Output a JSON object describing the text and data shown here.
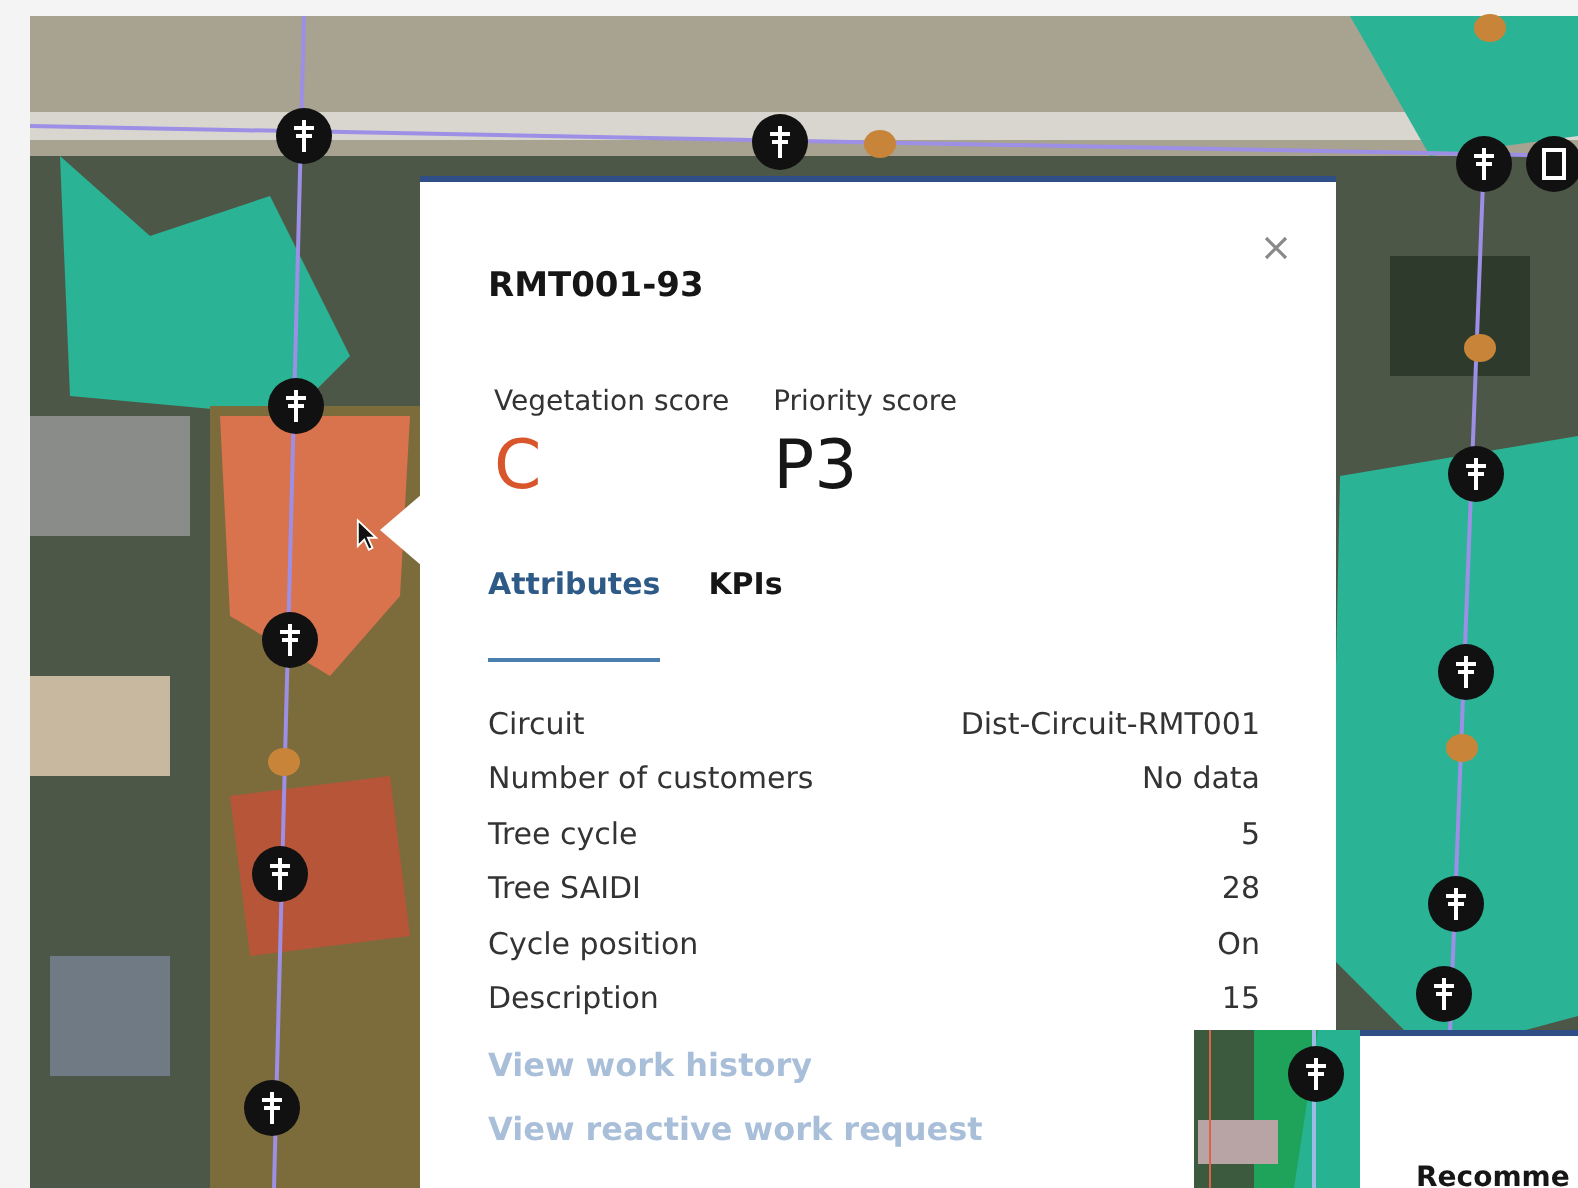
{
  "popup": {
    "title": "RMT001-93",
    "scores": [
      {
        "label": "Vegetation score",
        "value": "C",
        "color": "#d9552b"
      },
      {
        "label": "Priority score",
        "value": "P3",
        "color": "#161616"
      }
    ],
    "tabs": [
      {
        "label": "Attributes",
        "selected": true
      },
      {
        "label": "KPIs",
        "selected": false
      }
    ],
    "attributes": [
      {
        "label": "Circuit",
        "value": "Dist-Circuit-RMT001"
      },
      {
        "label": "Number of customers",
        "value": "No data"
      },
      {
        "label": "Tree cycle",
        "value": "5"
      },
      {
        "label": "Tree SAIDI",
        "value": "28"
      },
      {
        "label": "Cycle position",
        "value": "On"
      },
      {
        "label": "Description",
        "value": "15"
      }
    ],
    "links": [
      {
        "label": "View work history",
        "disabled": true
      },
      {
        "label": "View reactive work request",
        "disabled": true
      }
    ]
  },
  "second_panel": {
    "heading": "Recomme"
  }
}
